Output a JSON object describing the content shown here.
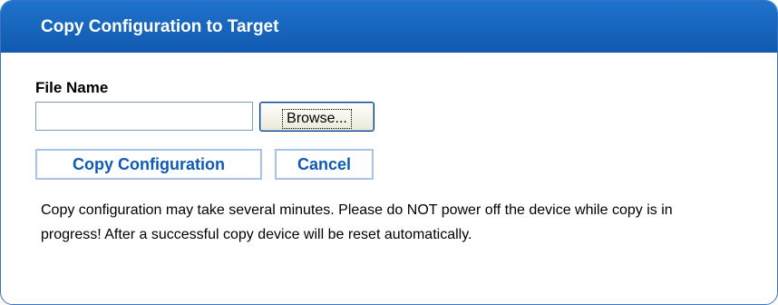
{
  "panel": {
    "title": "Copy Configuration to Target",
    "header_color": "#1565c0"
  },
  "form": {
    "file_label": "File Name",
    "file_input_value": "",
    "browse_label": "Browse...",
    "copy_label": "Copy Configuration",
    "cancel_label": "Cancel",
    "accent_color": "#0f5ab5"
  },
  "note": "Copy configuration may take several minutes. Please do NOT power off the device while copy is in progress! After a successful copy device will be reset automatically."
}
